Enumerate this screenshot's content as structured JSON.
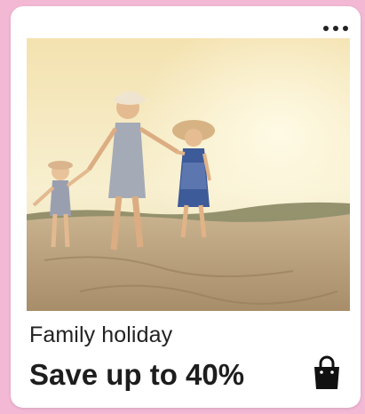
{
  "card": {
    "subtitle": "Family holiday",
    "headline": "Save up to 40%",
    "image_alt": "Mother and two children walking on a sunny beach",
    "icons": {
      "menu": "more-horizontal-icon",
      "cart": "shopping-bag-icon"
    }
  },
  "colors": {
    "page_background": "#f2b8d4",
    "card_background": "#ffffff",
    "text": "#1d1d1d"
  }
}
